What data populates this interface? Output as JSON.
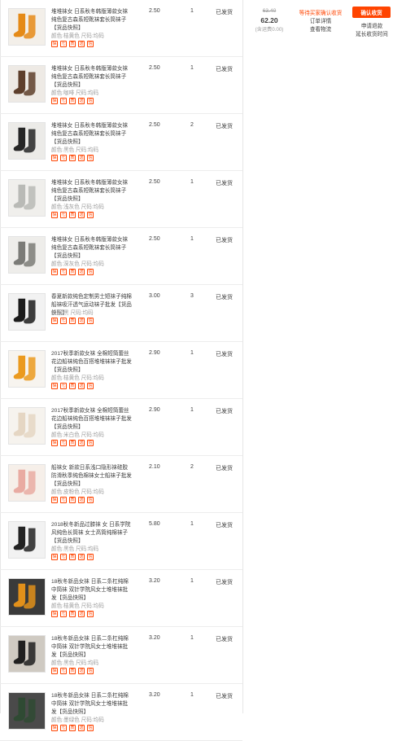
{
  "colors": {
    "accent": "#ff4400",
    "text": "#3c3c3c",
    "muted": "#9c9c9c",
    "border": "#e6e6e6"
  },
  "badge_icons": [
    "guarantee-icon",
    "seven-day-return-icon",
    "quality-icon",
    "delivery-icon",
    "credit-icon"
  ],
  "items": [
    {
      "title": "堆堆袜女 日系秋冬韩版薄款女袜 纯色复古森系短靴袜套长筒袜子【货品快照】",
      "sku": "颜色:桔黄色  尺码:均码",
      "price": "2.50",
      "qty": "1",
      "shipping": "已发货",
      "product_color": "#e58a17",
      "bg_color": "#f3efe9"
    },
    {
      "title": "堆堆袜女 日系秋冬韩版薄款女袜 纯色复古森系短靴袜套长筒袜子【货品快照】",
      "sku": "颜色:咖啡  尺码:均码",
      "price": "2.50",
      "qty": "1",
      "shipping": "已发货",
      "product_color": "#5e3f2c",
      "bg_color": "#eeeae5"
    },
    {
      "title": "堆堆袜女 日系秋冬韩版薄款女袜 纯色复古森系短靴袜套长筒袜子【货品快照】",
      "sku": "颜色:黑色  尺码:均码",
      "price": "2.50",
      "qty": "2",
      "shipping": "已发货",
      "product_color": "#262626",
      "bg_color": "#ecebe8"
    },
    {
      "title": "堆堆袜女 日系秋冬韩版薄款女袜 纯色复古森系短靴袜套长筒袜子【货品快照】",
      "sku": "颜色:浅灰色  尺码:均码",
      "price": "2.50",
      "qty": "1",
      "shipping": "已发货",
      "product_color": "#b9bab6",
      "bg_color": "#f0efec"
    },
    {
      "title": "堆堆袜女 日系秋冬韩版薄款女袜 纯色复古森系短靴袜套长筒袜子【货品快照】",
      "sku": "颜色:深灰色  尺码:均码",
      "price": "2.50",
      "qty": "1",
      "shipping": "已发货",
      "product_color": "#7b7b77",
      "bg_color": "#eeedea"
    },
    {
      "title": "春夏新款纯色定制男士短袜子纯棉船袜吸汗透气运动袜子批发【货品快照】",
      "sku": "颜色:黑  尺码:均码",
      "price": "3.00",
      "qty": "3",
      "shipping": "已发货",
      "product_color": "#1c1c1c",
      "bg_color": "#f2f2f2"
    },
    {
      "title": "2017秋季新款女袜 全棉短筒蕾丝花边船袜纯色百搭堆堆袜袜子批发【货品快照】",
      "sku": "颜色:桔黄色  尺码:均码",
      "price": "2.90",
      "qty": "1",
      "shipping": "已发货",
      "product_color": "#eb9a1e",
      "bg_color": "#f7f4ef"
    },
    {
      "title": "2017秋季新款女袜 全棉短筒蕾丝花边船袜纯色百搭堆堆袜袜子批发【货品快照】",
      "sku": "颜色:米白色  尺码:均码",
      "price": "2.90",
      "qty": "1",
      "shipping": "已发货",
      "product_color": "#e5d6c3",
      "bg_color": "#f6f3ee"
    },
    {
      "title": "船袜女 新款日系浅口隐形袜硅胶防滑秋季纯色棉袜女士船袜子批发【货品快照】",
      "sku": "颜色:皮粉色  尺码:均码",
      "price": "2.10",
      "qty": "2",
      "shipping": "已发货",
      "product_color": "#e9aba2",
      "bg_color": "#f6efe9"
    },
    {
      "title": "2018秋冬新品过膝袜 女 日系学院风纯色长筒袜 女士高筒纯棉袜子【货品快照】",
      "sku": "颜色:黑色  尺码:均码",
      "price": "5.80",
      "qty": "1",
      "shipping": "已发货",
      "product_color": "#232323",
      "bg_color": "#f2f2f2"
    },
    {
      "title": "18秋冬新品女袜 日系二条杠纯棉中筒袜 双针学院风女士堆堆袜批发【货品快照】",
      "sku": "颜色:桔黄色  尺码:均码",
      "price": "3.20",
      "qty": "1",
      "shipping": "已发货",
      "product_color": "#e2901a",
      "bg_color": "#3a3a3a"
    },
    {
      "title": "18秋冬新品女袜 日系二条杠纯棉中筒袜 双针学院风女士堆堆袜批发【货品快照】",
      "sku": "颜色:黑色  尺码:均码",
      "price": "3.20",
      "qty": "1",
      "shipping": "已发货",
      "product_color": "#202020",
      "bg_color": "#cfcac2"
    },
    {
      "title": "18秋冬新品女袜 日系二条杠纯棉中筒袜 双针学院风女士堆堆袜批发【货品快照】",
      "sku": "颜色:墨绿色  尺码:均码",
      "price": "3.20",
      "qty": "1",
      "shipping": "已发货",
      "product_color": "#2f4a33",
      "bg_color": "#4a4a4a"
    }
  ],
  "summary": {
    "original_price": "63.40",
    "total": "62.20",
    "freight": "(含运费0.00)",
    "status": "等待买家确认收货",
    "order_detail_link": "订单详情",
    "logistics_link": "查看物流",
    "confirm_button": "确认收货",
    "refund_link": "申请退款",
    "extend_link": "延长收货时间"
  }
}
